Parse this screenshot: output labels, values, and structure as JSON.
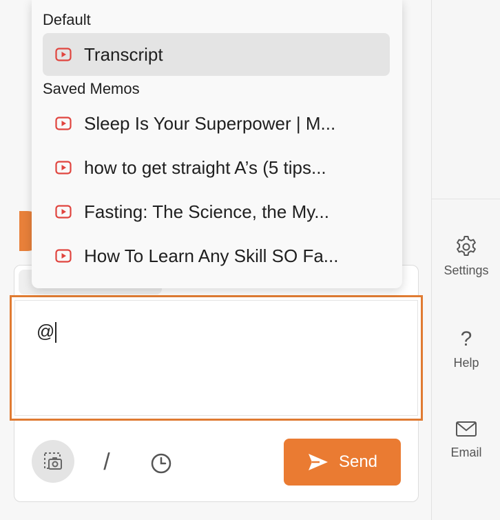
{
  "dropdown": {
    "default_heading": "Default",
    "default_item": {
      "label": "Transcript",
      "icon": "youtube-icon"
    },
    "saved_heading": "Saved Memos",
    "saved_items": [
      {
        "label": "Sleep Is Your Superpower | M...",
        "icon": "youtube-icon"
      },
      {
        "label": "how to get straight A’s (5 tips...",
        "icon": "youtube-icon"
      },
      {
        "label": "Fasting: The Science, the My...",
        "icon": "youtube-icon"
      },
      {
        "label": "How To Learn Any Skill SO Fa...",
        "icon": "youtube-icon"
      }
    ]
  },
  "input": {
    "value": "@"
  },
  "toolbar": {
    "media_icon": "screenshot-icon",
    "slash_label": "/",
    "history_icon": "clock-icon",
    "send_label": "Send"
  },
  "sidebar": {
    "settings_label": "Settings",
    "help_label": "Help",
    "email_label": "Email"
  },
  "colors": {
    "accent": "#ea7b32",
    "focus_border": "#e07b32",
    "youtube_red": "#e0443e"
  }
}
